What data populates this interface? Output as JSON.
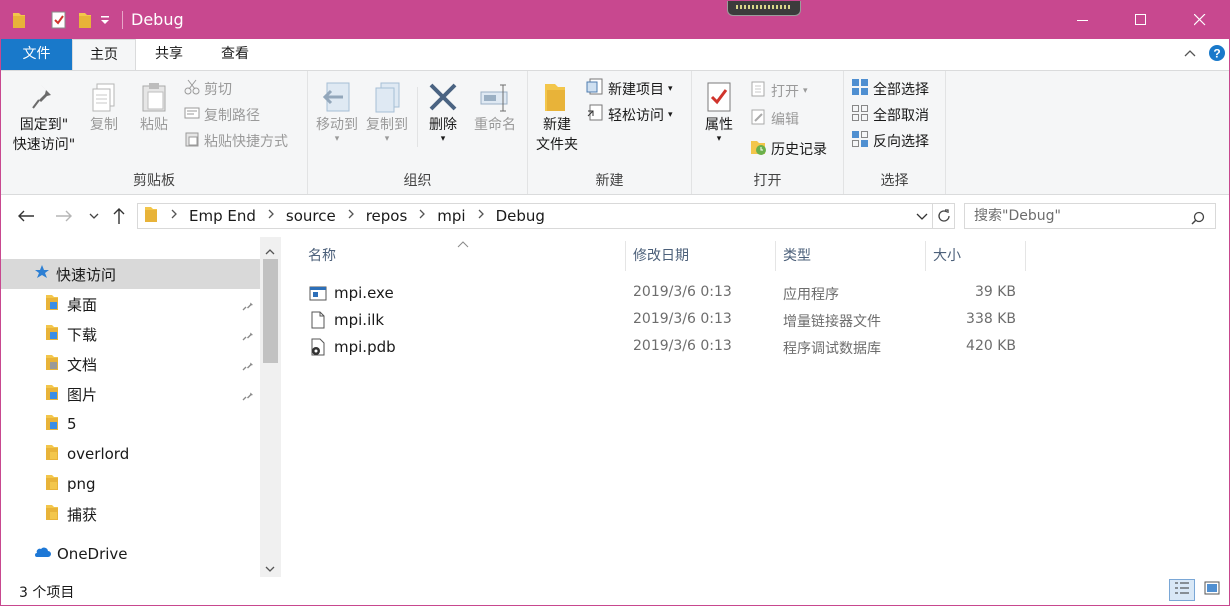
{
  "window": {
    "title": "Debug"
  },
  "tabs": {
    "file": "文件",
    "home": "主页",
    "share": "共享",
    "view": "查看"
  },
  "ribbon": {
    "clipboard": {
      "label": "剪贴板",
      "pin": "固定到\"\n快速访问\"",
      "pin_l1": "固定到\"",
      "pin_l2": "快速访问\"",
      "copy": "复制",
      "paste": "粘贴",
      "cut": "剪切",
      "copy_path": "复制路径",
      "paste_shortcut": "粘贴快捷方式"
    },
    "organize": {
      "label": "组织",
      "move_to": "移动到",
      "copy_to": "复制到",
      "delete": "删除",
      "rename": "重命名"
    },
    "new": {
      "label": "新建",
      "new_folder_l1": "新建",
      "new_folder_l2": "文件夹",
      "new_item": "新建项目",
      "easy_access": "轻松访问"
    },
    "open": {
      "label": "打开",
      "properties": "属性",
      "open": "打开",
      "edit": "编辑",
      "history": "历史记录"
    },
    "select": {
      "label": "选择",
      "select_all": "全部选择",
      "select_none": "全部取消",
      "invert": "反向选择"
    }
  },
  "address": {
    "crumbs": [
      "Emp End",
      "source",
      "repos",
      "mpi",
      "Debug"
    ],
    "search_placeholder": "搜索\"Debug\""
  },
  "nav": {
    "quick_access": "快速访问",
    "items": [
      {
        "label": "桌面",
        "pinned": true
      },
      {
        "label": "下载",
        "pinned": true
      },
      {
        "label": "文档",
        "pinned": true
      },
      {
        "label": "图片",
        "pinned": true
      },
      {
        "label": "5",
        "pinned": false
      },
      {
        "label": "overlord",
        "pinned": false
      },
      {
        "label": "png",
        "pinned": false
      },
      {
        "label": "捕获",
        "pinned": false
      }
    ],
    "onedrive": "OneDrive"
  },
  "columns": {
    "name": "名称",
    "date": "修改日期",
    "type": "类型",
    "size": "大小"
  },
  "files": [
    {
      "name": "mpi.exe",
      "date": "2019/3/6 0:13",
      "type": "应用程序",
      "size": "39 KB",
      "icon": "exe-icon"
    },
    {
      "name": "mpi.ilk",
      "date": "2019/3/6 0:13",
      "type": "增量链接器文件",
      "size": "338 KB",
      "icon": "file-icon"
    },
    {
      "name": "mpi.pdb",
      "date": "2019/3/6 0:13",
      "type": "程序调试数据库",
      "size": "420 KB",
      "icon": "pdb-icon"
    }
  ],
  "status": {
    "count": "3 个项目"
  },
  "colors": {
    "titlebar": "#c8488f",
    "file_tab": "#1979ca",
    "ribbon_bg": "#f5f6f7"
  }
}
